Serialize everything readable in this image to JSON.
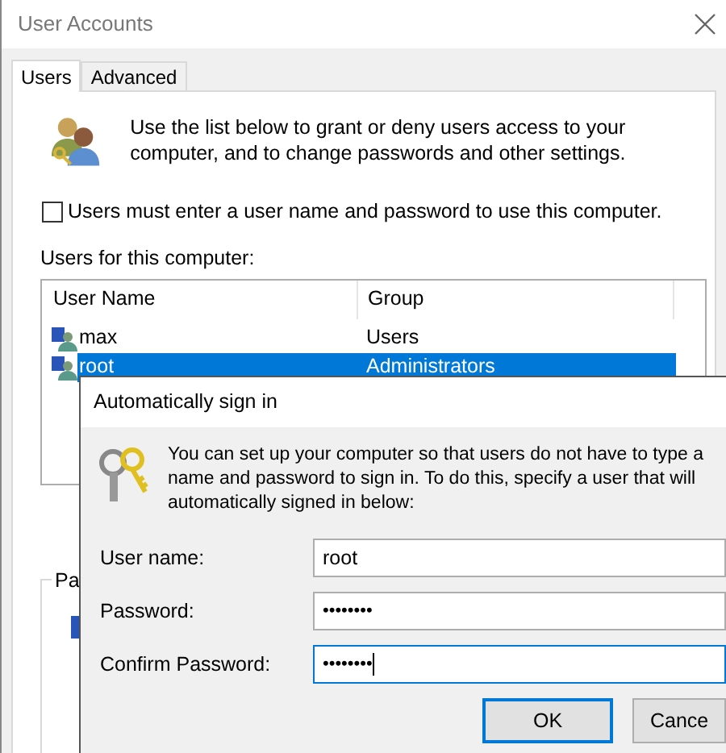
{
  "window": {
    "title": "User Accounts"
  },
  "tabs": [
    {
      "label": "Users",
      "selected": true
    },
    {
      "label": "Advanced",
      "selected": false
    }
  ],
  "intro": "Use the list below to grant or deny users access to your computer, and to change passwords and other settings.",
  "must_enter_checkbox": {
    "label": "Users must enter a user name and password to use this computer.",
    "checked": false
  },
  "users_label": "Users for this computer:",
  "users_table": {
    "columns": [
      "User Name",
      "Group"
    ],
    "rows": [
      {
        "name": "max",
        "group": "Users",
        "selected": false
      },
      {
        "name": "root",
        "group": "Administrators",
        "selected": true
      }
    ]
  },
  "password_group": {
    "label": "Pa"
  },
  "dialog": {
    "title": "Automatically sign in",
    "description_lines": [
      "You can set up your computer so that users do not have to type a",
      "name and password to sign in. To do this, specify a user that will",
      "automatically signed in below:"
    ],
    "fields": [
      {
        "label": "User name:",
        "value": "root",
        "kind": "text"
      },
      {
        "label": "Password:",
        "value": "••••••••",
        "kind": "password"
      },
      {
        "label": "Confirm Password:",
        "value": "••••••••",
        "kind": "password",
        "focused": true
      }
    ],
    "buttons": [
      {
        "label": "OK",
        "default": true
      },
      {
        "label": "Cance",
        "default": false
      }
    ]
  }
}
